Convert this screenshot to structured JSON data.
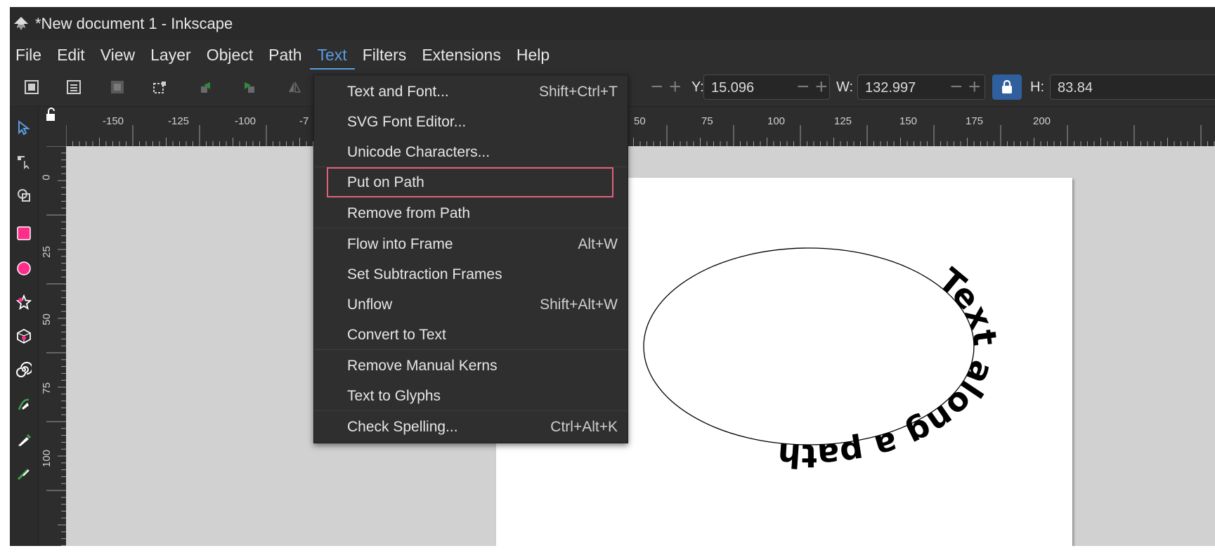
{
  "window": {
    "title": "*New document 1 - Inkscape"
  },
  "menubar": [
    "File",
    "Edit",
    "View",
    "Layer",
    "Object",
    "Path",
    "Text",
    "Filters",
    "Extensions",
    "Help"
  ],
  "toolbar": {
    "y_label": "Y:",
    "y_value": "15.096",
    "w_label": "W:",
    "w_value": "132.997",
    "h_label": "H:",
    "h_value": "83.84",
    "minus": "−",
    "plus": "+"
  },
  "text_menu": {
    "items": [
      {
        "label": "Text and Font...",
        "shortcut": "Shift+Ctrl+T"
      },
      {
        "label": "SVG Font Editor...",
        "shortcut": ""
      },
      {
        "label": "Unicode Characters...",
        "shortcut": ""
      },
      {
        "label": "Put on Path",
        "shortcut": ""
      },
      {
        "label": "Remove from Path",
        "shortcut": ""
      },
      {
        "label": "Flow into Frame",
        "shortcut": "Alt+W"
      },
      {
        "label": "Set Subtraction Frames",
        "shortcut": ""
      },
      {
        "label": "Unflow",
        "shortcut": "Shift+Alt+W"
      },
      {
        "label": "Convert to Text",
        "shortcut": ""
      },
      {
        "label": "Remove Manual Kerns",
        "shortcut": ""
      },
      {
        "label": "Text to Glyphs",
        "shortcut": ""
      },
      {
        "label": "Check Spelling...",
        "shortcut": "Ctrl+Alt+K"
      }
    ]
  },
  "rulers": {
    "horizontal_left": [
      "-150",
      "-125",
      "-100",
      "-7"
    ],
    "horizontal_right": [
      "50",
      "75",
      "100",
      "125",
      "150",
      "175",
      "200"
    ],
    "vertical": [
      "0",
      "25",
      "50",
      "75",
      "100"
    ]
  },
  "canvas": {
    "text_on_path": "Text along a path"
  },
  "colors": {
    "accent": "#5a9be0",
    "highlight_box": "#e0607e",
    "rect_tool": "#ff2d8a",
    "circle_tool": "#ff2d8a"
  }
}
